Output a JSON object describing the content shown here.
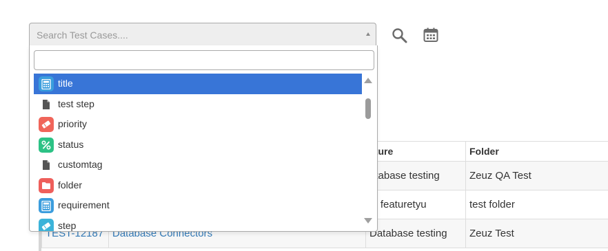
{
  "search": {
    "placeholder": "Search Test Cases....",
    "dropdown_filter_value": ""
  },
  "toolbar": {
    "search_icon": "magnifier-icon",
    "calendar_icon": "calendar-icon"
  },
  "options": [
    {
      "label": "title",
      "icon": "calculator-icon",
      "color": "#3b9ddd",
      "selected": true
    },
    {
      "label": "test step",
      "icon": "file-icon",
      "color": "#555555",
      "selected": false
    },
    {
      "label": "priority",
      "icon": "ticket-icon",
      "color": "#f0655a",
      "selected": false
    },
    {
      "label": "status",
      "icon": "percent-icon",
      "color": "#2cc285",
      "selected": false
    },
    {
      "label": "customtag",
      "icon": "file-icon",
      "color": "#555555",
      "selected": false
    },
    {
      "label": "folder",
      "icon": "folder-icon",
      "color": "#ee5f5b",
      "selected": false
    },
    {
      "label": "requirement",
      "icon": "calculator-icon",
      "color": "#3b9ddd",
      "selected": false
    },
    {
      "label": "step",
      "icon": "ticket-icon",
      "color": "#3cb3d9",
      "selected": false
    }
  ],
  "colors": {
    "selected_bg": "#3875d7",
    "link": "#337ab7"
  },
  "table": {
    "headers": {
      "feature": "ature",
      "folder": "Folder"
    },
    "rows": [
      {
        "id": "",
        "title": "",
        "feature": "atabase testing",
        "folder": "Zeuz QA Test"
      },
      {
        "id": "",
        "title": "",
        "feature": "st featuretyu",
        "folder": "test folder"
      },
      {
        "id": "TEST-12187",
        "title": "Database Connectors",
        "feature": "Database testing",
        "folder": "Zeuz Test"
      }
    ]
  }
}
